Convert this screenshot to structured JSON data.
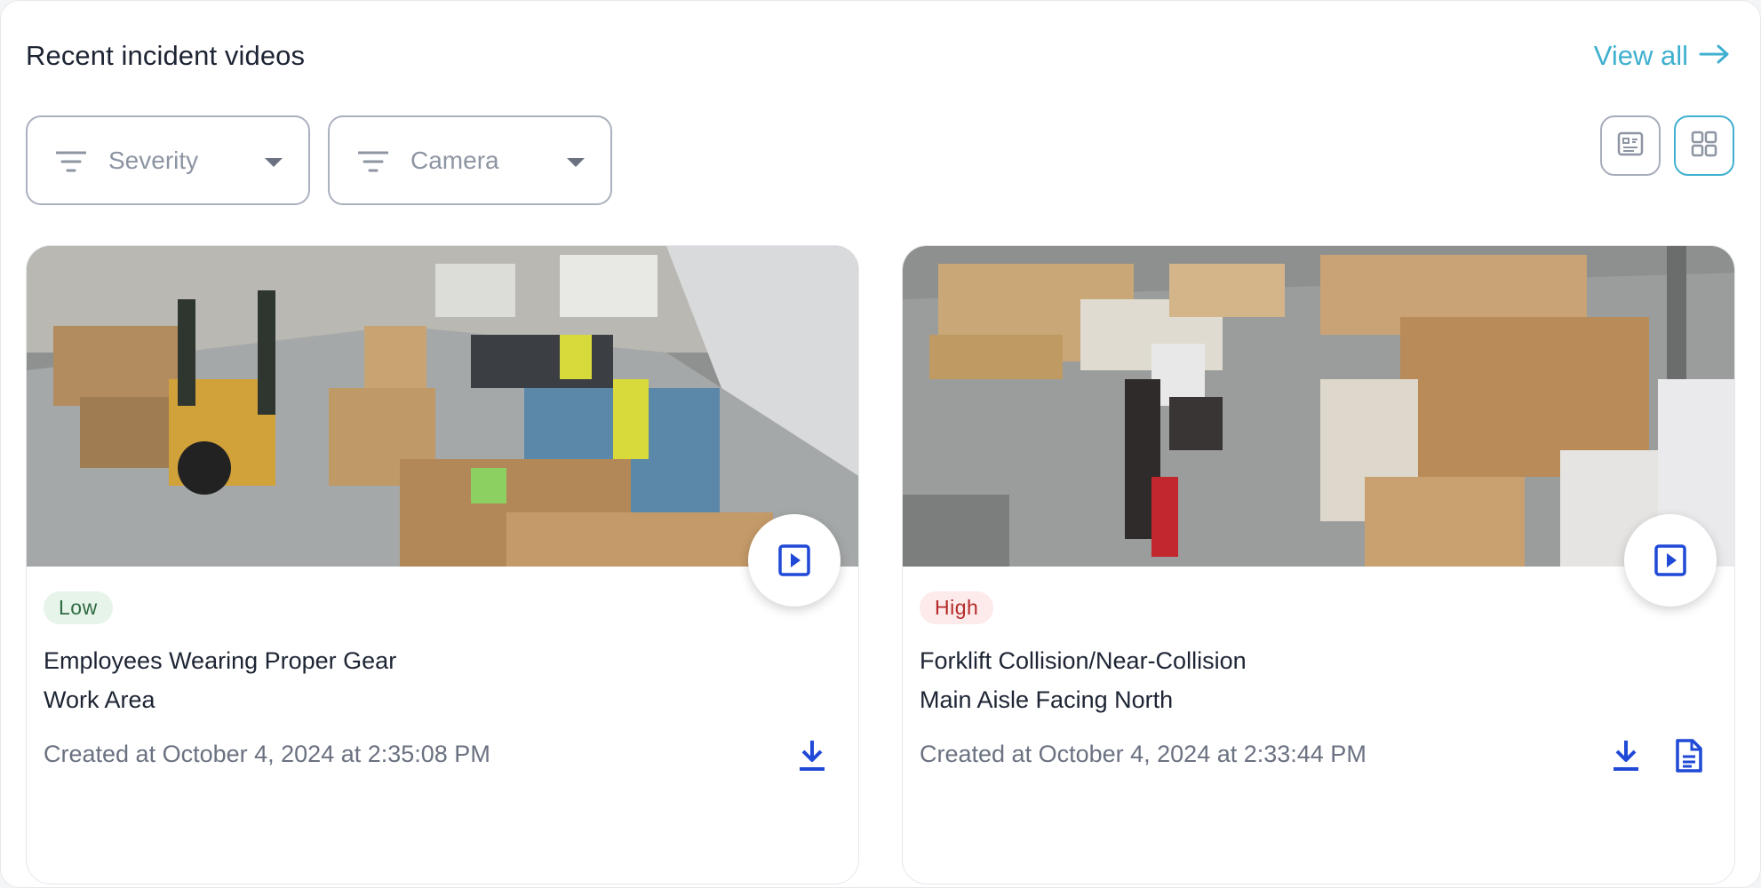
{
  "header": {
    "title": "Recent incident videos",
    "view_all_label": "View all",
    "accent_color": "#3fb0cf"
  },
  "filters": [
    {
      "label": "Severity",
      "icon": "filter-icon"
    },
    {
      "label": "Camera",
      "icon": "filter-icon"
    }
  ],
  "view_toggle": {
    "list_icon": "list-view-icon",
    "grid_icon": "grid-view-icon",
    "selected": "grid"
  },
  "cards": [
    {
      "severity": "Low",
      "severity_color": "#2f6b43",
      "title": "Employees Wearing Proper Gear",
      "location": "Work Area",
      "created": "Created at October 4, 2024 at 2:35:08 PM",
      "actions": [
        "download-icon"
      ]
    },
    {
      "severity": "High",
      "severity_color": "#b42a2a",
      "title": "Forklift Collision/Near-Collision",
      "location": "Main Aisle Facing North",
      "created": "Created at October 4, 2024 at 2:33:44 PM",
      "actions": [
        "download-icon",
        "report-document-icon"
      ]
    }
  ],
  "colors": {
    "link_blue": "#1f49d6"
  }
}
